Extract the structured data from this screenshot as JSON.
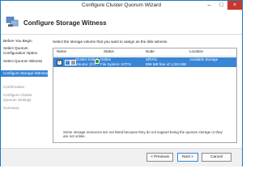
{
  "window": {
    "title": "Configure Cluster Quorum Wizard"
  },
  "header": {
    "title": "Configure Storage Witness"
  },
  "sidebar": {
    "items": [
      {
        "label": "Before You Begin"
      },
      {
        "label": "Select Quorum Configuration Option"
      },
      {
        "label": "Select Quorum Witness"
      },
      {
        "label": "Configure Storage Witness"
      },
      {
        "label": "Confirmation"
      },
      {
        "label": "Configure Cluster Quorum Settings"
      },
      {
        "label": "Summary"
      }
    ]
  },
  "main": {
    "instruction": "Select the storage volume that you want to assign as the disk witness.",
    "columns": [
      "Name",
      "Status",
      "Node",
      "Location"
    ],
    "rows": [
      {
        "name": "Cluster Disk 2",
        "sub_name": "Volume: (\\\\?\\...",
        "status": "Online",
        "sub_status": "File System: NTFS",
        "node": "SRV01",
        "sub_node": "896 MB free of 1,024 MB",
        "location": "Available Storage"
      }
    ],
    "footnote": "Some storage resources are not listed because they do not support being the quorum storage or they are not online."
  },
  "buttons": {
    "previous": "< Previous",
    "next": "Next >",
    "cancel": "Cancel"
  },
  "colors": {
    "accent": "#3a86d6",
    "close": "#c8372d"
  }
}
